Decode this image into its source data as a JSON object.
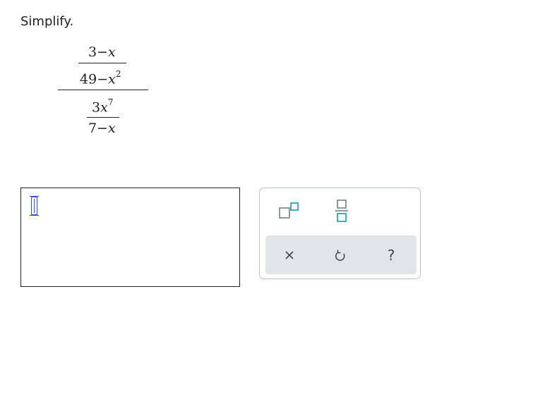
{
  "prompt": "Simplify.",
  "expression": {
    "top_numerator": {
      "coef": "3",
      "op": "−",
      "var": "x"
    },
    "top_denominator": {
      "coef": "49",
      "op": "−",
      "var": "x",
      "exp": "2"
    },
    "bottom_numerator": {
      "coef": "3",
      "var": "x",
      "exp": "7"
    },
    "bottom_denominator": {
      "coef": "7",
      "op": "−",
      "var": "x"
    }
  },
  "answer": {
    "value": ""
  },
  "palette": {
    "tools": [
      {
        "name": "superscript-tool",
        "icon": "superscript-icon"
      },
      {
        "name": "fraction-tool",
        "icon": "fraction-icon"
      }
    ],
    "actions": [
      {
        "name": "clear",
        "icon": "close-icon"
      },
      {
        "name": "undo",
        "icon": "undo-icon"
      },
      {
        "name": "help",
        "icon": "help-icon",
        "glyph": "?"
      }
    ]
  },
  "colors": {
    "accent": "#2ea6b6",
    "icon_gray": "#6b7780",
    "icon_dark": "#3a4750",
    "action_bar": "#dfe5e9",
    "palette_border": "#b9c4cc",
    "cursor": "#3b4dd1"
  }
}
